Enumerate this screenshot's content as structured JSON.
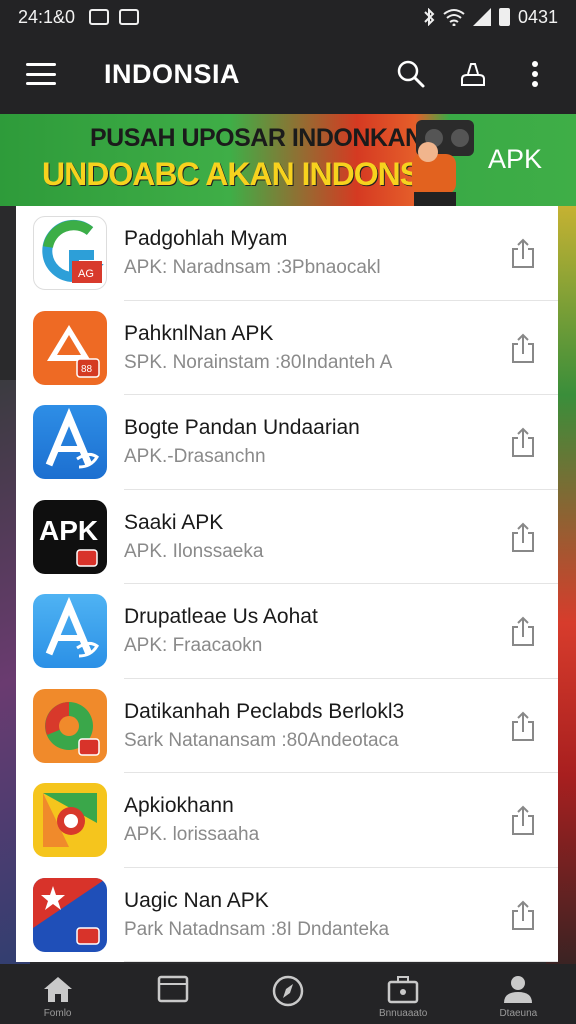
{
  "status_bar": {
    "time": "24:1&0",
    "battery_text": "0431"
  },
  "app_bar": {
    "title": "INDONSIA"
  },
  "banner": {
    "line1": "PUSAH UPOSAR INDONKAN",
    "line2": "UNDOABC AKAN INDONSIA",
    "apk_label": "APK"
  },
  "apps": [
    {
      "name": "Padgohlah Myam",
      "subtitle": "APK: Naradnsam :3Pbnaocakl",
      "icon": "green-red-g-icon"
    },
    {
      "name": "PahknlNan APK",
      "subtitle": "SPK. Norainstam :80Indanteh A",
      "icon": "orange-a-icon"
    },
    {
      "name": "Bogte Pandan Undaarian",
      "subtitle": "APK.-Drasanchn",
      "icon": "blue-a-icon"
    },
    {
      "name": "Saaki APK",
      "subtitle": "APK. Ilonssaeka",
      "icon": "black-apk-icon"
    },
    {
      "name": "Drupatleae Us Aohat",
      "subtitle": "APK: Fraacaokn",
      "icon": "light-blue-a-icon"
    },
    {
      "name": "Datikanhah Peclabds Berlokl3",
      "subtitle": "Sark Natanansam :80Andeotaca",
      "icon": "orange-green-circle-icon"
    },
    {
      "name": "Apkiokhann",
      "subtitle": "APK. lorissaaha",
      "icon": "yellow-green-red-icon"
    },
    {
      "name": "Uagic Nan APK",
      "subtitle": "Park Natadnsam :8I Dndanteka",
      "icon": "red-blue-star-icon"
    }
  ],
  "bottom_nav": [
    {
      "label": "Fomlo",
      "icon": "home-icon"
    },
    {
      "label": "",
      "icon": "window-icon"
    },
    {
      "label": "",
      "icon": "compass-icon"
    },
    {
      "label": "Bnnuaaato",
      "icon": "briefcase-icon"
    },
    {
      "label": "Dtaeuna",
      "icon": "profile-icon"
    }
  ]
}
